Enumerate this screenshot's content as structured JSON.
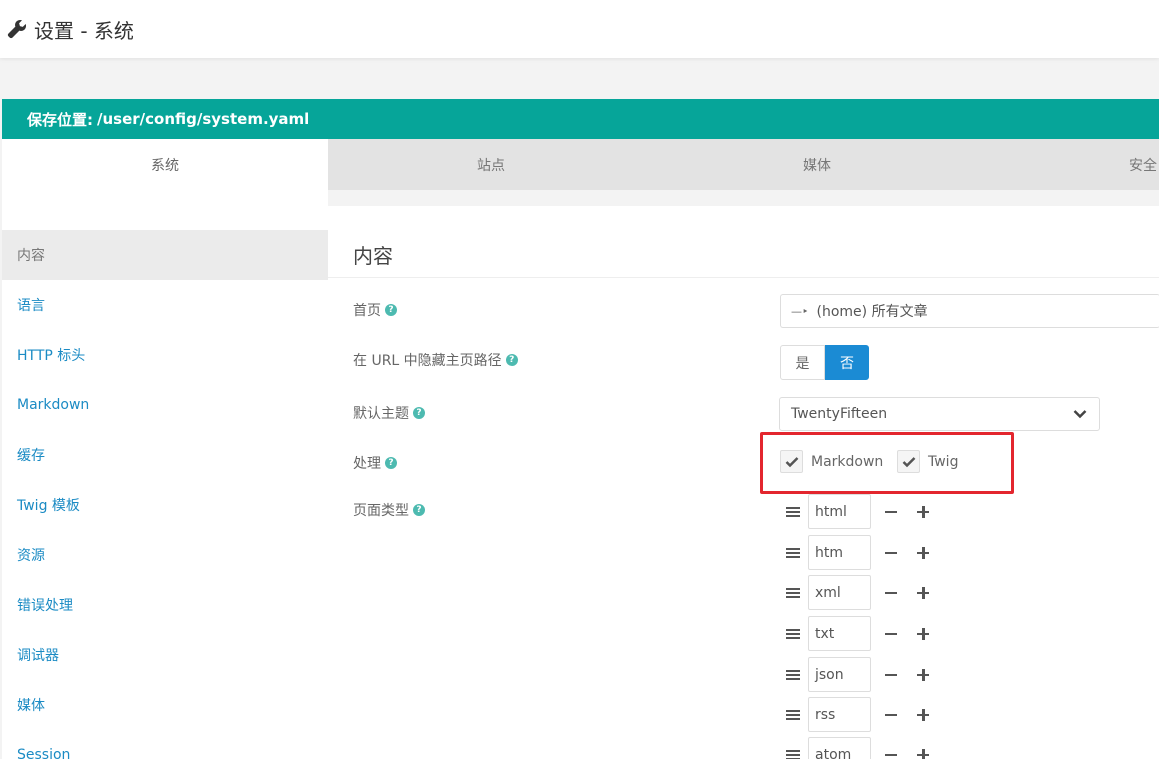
{
  "header": {
    "title": "设置 - 系统",
    "icon": "wrench-icon"
  },
  "save_bar": {
    "label": "保存位置:",
    "path": "/user/config/system.yaml",
    "color": "#06a599"
  },
  "tabs": [
    {
      "label": "系统",
      "active": true
    },
    {
      "label": "站点",
      "active": false
    },
    {
      "label": "媒体",
      "active": false
    },
    {
      "label": "安全",
      "active": false
    }
  ],
  "sidebar": {
    "items": [
      {
        "label": "内容",
        "active": true
      },
      {
        "label": "语言"
      },
      {
        "label": "HTTP 标头"
      },
      {
        "label": "Markdown"
      },
      {
        "label": "缓存"
      },
      {
        "label": "Twig 模板"
      },
      {
        "label": "资源"
      },
      {
        "label": "错误处理"
      },
      {
        "label": "调试器"
      },
      {
        "label": "媒体"
      },
      {
        "label": "Session"
      }
    ]
  },
  "content": {
    "section_title": "内容",
    "fields": {
      "home": {
        "label": "首页",
        "prefix": "—‣",
        "value": "(home) 所有文章"
      },
      "hide_home_route": {
        "label": "在 URL 中隐藏主页路径",
        "yes": "是",
        "no": "否",
        "selected": "否"
      },
      "default_theme": {
        "label": "默认主题",
        "value": "TwentyFifteen"
      },
      "process": {
        "label": "处理",
        "options": [
          {
            "label": "Markdown",
            "checked": true
          },
          {
            "label": "Twig",
            "checked": true
          }
        ]
      },
      "page_types": {
        "label": "页面类型",
        "values": [
          "html",
          "htm",
          "xml",
          "txt",
          "json",
          "rss",
          "atom"
        ]
      }
    }
  },
  "colors": {
    "accent": "#1b8bd4",
    "help_icon": "#4dbab0",
    "highlight": "#e3262e"
  }
}
